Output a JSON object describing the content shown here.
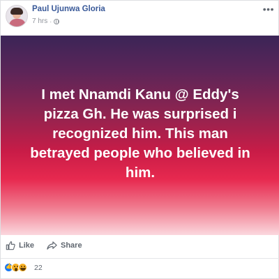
{
  "post": {
    "author_name": "Paul Ujunwa Gloria",
    "timestamp": "7 hrs",
    "separator": "·",
    "privacy_icon": "globe-icon",
    "options_label": "•••",
    "status_text": "I met Nnamdi Kanu @ Eddy's pizza Gh. He was surprised i recognized him. This man betrayed people who believed in him.",
    "background_colors": [
      "#3b2557",
      "#8c2450",
      "#c81c47",
      "#e7294f",
      "#fbd8de"
    ]
  },
  "actions": {
    "like_label": "Like",
    "share_label": "Share",
    "like_icon": "thumbs-up-icon",
    "share_icon": "share-arrow-icon"
  },
  "reactions": {
    "icons": [
      "like-reaction-icon",
      "wow-reaction-icon",
      "haha-reaction-icon"
    ],
    "count": "22"
  },
  "colors": {
    "name_link": "#385898",
    "secondary_text": "#90949c",
    "action_text": "#606770"
  }
}
